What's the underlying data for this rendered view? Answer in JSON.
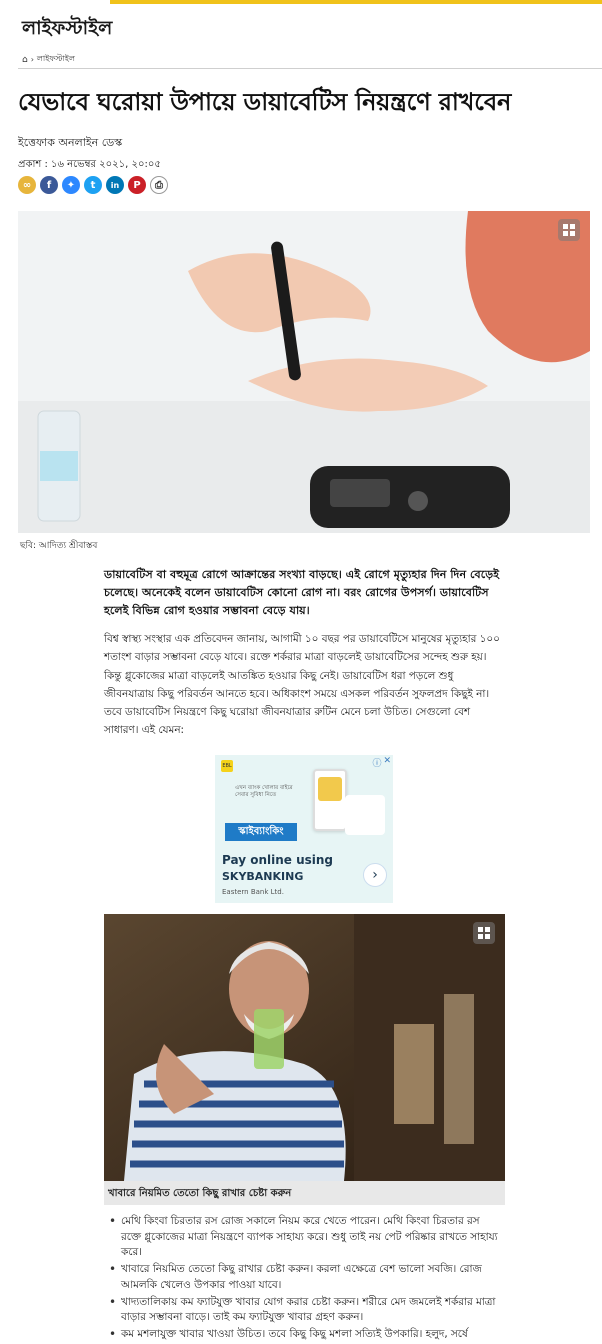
{
  "section": {
    "title": "লাইফস্টাইল"
  },
  "breadcrumb": {
    "home_icon": "home-icon",
    "separator": "›",
    "current": "লাইফস্টাইল"
  },
  "article": {
    "headline": "যেভাবে ঘরোয়া উপায়ে ডায়াবেটিস নিয়ন্ত্রণে রাখবেন",
    "author": "ইত্তেফাক অনলাইন ডেস্ক",
    "published": "প্রকাশ : ১৬ নভেম্বর ২০২১, ২০:০৫",
    "hero_caption": "ছবি: আদিত্য শ্রীবাস্তব",
    "lead": "ডায়াবেটিস বা বহুমূত্র রোগে আক্রান্তের সংখ্যা বাড়ছে। এই রোগে মৃত্যুহার দিন দিন বেড়েই চলেছে। অনেকেই বলেন ডায়াবেটিস কোনো রোগ না। বরং রোগের উপসর্গ। ডায়াবেটিস হলেই বিভিন্ন রোগ হওয়ার সম্ভাবনা বেড়ে যায়।",
    "body": "বিশ্ব স্বাস্থ্য সংস্থার এক প্রতিবেদন জানায়, আগামী ১০ বছর পর ডায়াবেটিসে মানুষের মৃত্যুহার ১০০ শতাংশ বাড়ার সম্ভাবনা বেড়ে যাবে। রক্তে শর্করার মাত্রা বাড়লেই ডায়াবেটিসের সন্দেহ শুরু হয়। কিন্তু গ্লুকোজের মাত্রা বাড়লেই আতঙ্কিত হওয়ার কিছু নেই। ডায়াবেটিস ধরা পড়লে শুধু জীবনযাত্রায় কিছু পরিবর্তন আনতে হবে। অধিকাংশ সময়ে এসকল পরিবর্তন সুফলপ্রদ কিছুই না। তবে ডায়াবেটিস নিয়ন্ত্রণে কিছু ঘরোয়া জীবনযাত্রার রুটিন মেনে চলা উচিত। সেগুলো বেশ সাধারণ। এই যেমন:",
    "photo2_caption": "খাবারে নিয়মিত তেতো কিছু রাখার চেষ্টা করুন",
    "bullets": [
      "মেথি কিংবা চিরতার রস রোজ সকালে নিয়ম করে খেতে পারেন। মেথি কিংবা চিরতার রস রক্তে গ্লুকোজের মাত্রা নিয়ন্ত্রণে ব্যাপক সাহায্য করে। শুধু তাই নয় পেট পরিষ্কার রাখতে সাহায্য করে।",
      "খাবারে নিয়মিত তেতো কিছু রাখার চেষ্টা করুন। করলা এক্ষেত্রে বেশ ভালো সবজি। রোজ আমলকি খেলেও উপকার পাওয়া যাবে।",
      "খাদ্যতালিকায় কম ফ্যাটযুক্ত খাবার যোগ করার চেষ্টা করুন। শরীরে মেদ জমলেই শর্করার মাত্রা বাড়ার সম্ভাবনা বাড়ে। তাই কম ফ্যাটযুক্ত খাবার গ্রহণ করুন।",
      "কম মশলাযুক্ত খাবার খাওয়া উচিত। তবে কিছু কিছু মশলা সত্যিই উপকারি। হলুদ, সর্ষে"
    ]
  },
  "share": {
    "icons": [
      "link-icon",
      "facebook-icon",
      "messenger-icon",
      "twitter-icon",
      "linkedin-icon",
      "pinterest-icon",
      "print-icon"
    ],
    "glyphs": [
      "∞",
      "f",
      "✦",
      "t",
      "in",
      "P",
      "⎙"
    ],
    "colors": [
      "#e7b53b",
      "#3b5998",
      "#2d88ff",
      "#1da1f2",
      "#0077b5",
      "#cb2027",
      "#ffffff"
    ]
  },
  "ad": {
    "logo": "EBL",
    "banner_text": "এখন ব্যাংক খোলার বাইরে সেবার সুবিধা নিতে",
    "brand_bn": "স্কাইব্যাংকিং",
    "line1": "Pay online using",
    "line2": "SKYBANKING",
    "line3": "Eastern Bank Ltd.",
    "next": "›",
    "info": "ⓘ",
    "close": "✕"
  },
  "colors": {
    "accent_strip": "#f0c21a",
    "ad_bg": "#e7f5f5",
    "caption_bg": "#e8e8e8"
  }
}
